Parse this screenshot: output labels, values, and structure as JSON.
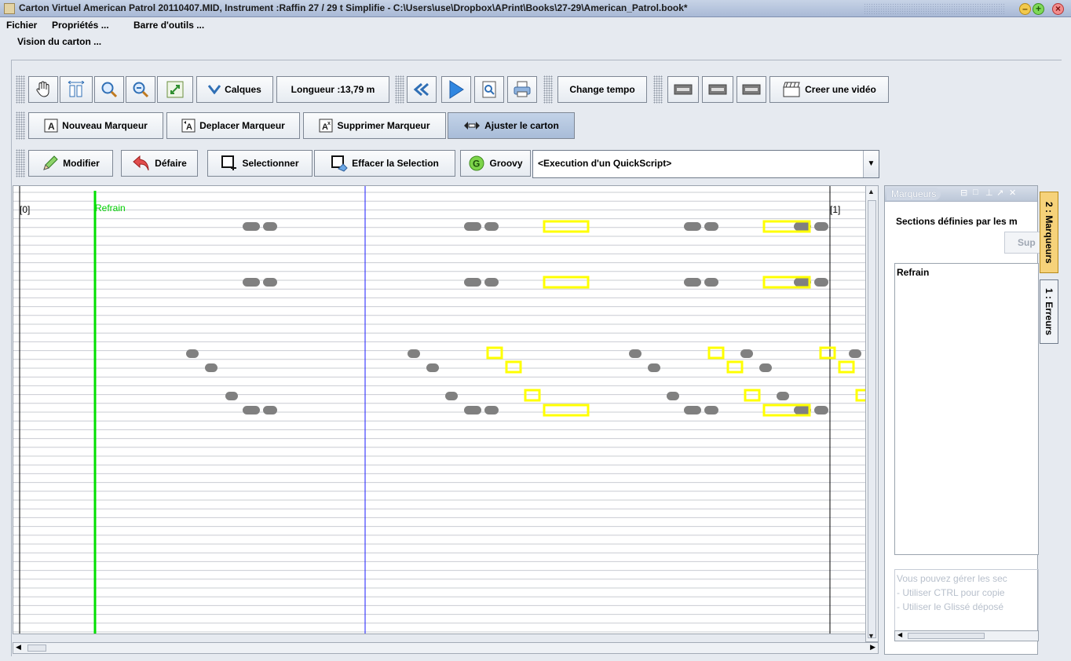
{
  "window": {
    "title": "Carton Virtuel  American Patrol 20110407.MID, Instrument :Raffin 27 / 29 t Simplifie - C:\\Users\\use\\Dropbox\\APrint\\Books\\27-29\\American_Patrol.book*"
  },
  "menubar": {
    "items": [
      "Fichier",
      "Propriétés ...",
      "Barre d'outils ..."
    ]
  },
  "vision": {
    "group_label": "Vision du carton ...",
    "toolbar1": {
      "calques_label": "Calques",
      "length_label": "Longueur :13,79 m",
      "change_tempo_label": "Change tempo",
      "create_video_label": "Creer une vidéo"
    },
    "toolbar2": {
      "new_marker_label": "Nouveau Marqueur",
      "move_marker_label": "Deplacer Marqueur",
      "delete_marker_label": "Supprimer Marqueur",
      "adjust_label": "Ajuster le carton"
    },
    "toolbar3": {
      "modify_label": "Modifier",
      "undo_label": "Défaire",
      "select_label": "Selectionner",
      "clear_selection_label": "Effacer la Selection",
      "groovy_label": "Groovy",
      "script_select_value": "<Execution d'un QuickScript>"
    }
  },
  "canvas": {
    "marker_start_label": "[0]",
    "marker_end_label": "[1]",
    "refrain_label": "Refrain",
    "colors": {
      "refrain_line": "#00e000",
      "cursor_line": "#1a1aff",
      "note": "#808080",
      "selected_note": "#ffff00"
    }
  },
  "panel": {
    "tab_label": "Marqueurs",
    "sections_label": "Sections définies par les m",
    "delete_button_label": "Sup",
    "list_items": [
      "Refrain"
    ],
    "hint_lines": [
      "Vous pouvez gérer les sec",
      " - Utiliser CTRL pour copie",
      " - Utiliser le Glissé déposé"
    ]
  },
  "side_tabs": {
    "markers": "2 : Marqueurs",
    "errors": "1 : Erreurs"
  }
}
